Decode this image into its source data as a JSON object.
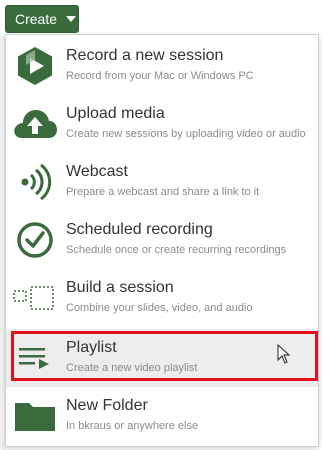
{
  "create_button": {
    "label": "Create"
  },
  "menu": {
    "items": [
      {
        "title": "Record a new session",
        "subtitle": "Record from your Mac or Windows PC",
        "icon": "panopto-record-icon"
      },
      {
        "title": "Upload media",
        "subtitle": "Create new sessions by uploading video or audio",
        "icon": "cloud-upload-icon"
      },
      {
        "title": "Webcast",
        "subtitle": "Prepare a webcast and share a link to it",
        "icon": "broadcast-icon"
      },
      {
        "title": "Scheduled recording",
        "subtitle": "Schedule once or create recurring recordings",
        "icon": "clock-icon"
      },
      {
        "title": "Build a session",
        "subtitle": "Combine your slides, video, and audio",
        "icon": "build-session-icon"
      },
      {
        "title": "Playlist",
        "subtitle": "Create a new video playlist",
        "icon": "playlist-icon",
        "highlighted": true
      },
      {
        "title": "New Folder",
        "subtitle": "In bkraus or anywhere else",
        "icon": "folder-icon"
      }
    ]
  },
  "colors": {
    "brand_green": "#3a6b3c",
    "highlight_red": "#e0121c",
    "hover_bg": "#ededed"
  }
}
